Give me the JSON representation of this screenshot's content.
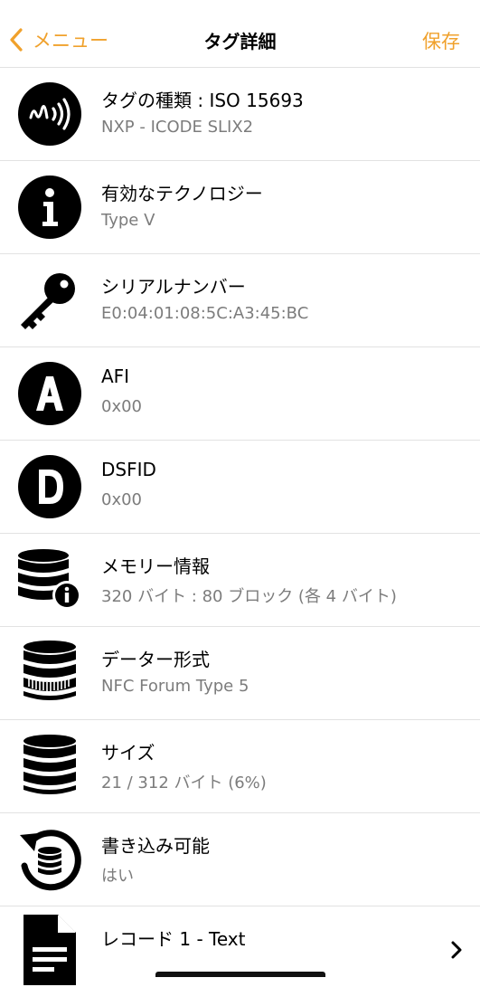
{
  "nav": {
    "back_label": "メニュー",
    "title": "タグ詳細",
    "save_label": "保存"
  },
  "rows": [
    {
      "title": "タグの種類 : ISO 15693",
      "value": "NXP - ICODE SLIX2",
      "icon": "nfc-tag-icon"
    },
    {
      "title": "有効なテクノロジー",
      "value": "Type V",
      "icon": "info-icon"
    },
    {
      "title": "シリアルナンバー",
      "value": "E0:04:01:08:5C:A3:45:BC",
      "icon": "key-icon"
    },
    {
      "title": "AFI",
      "value": "0x00",
      "icon": "letter-a-icon"
    },
    {
      "title": "DSFID",
      "value": "0x00",
      "icon": "letter-d-icon"
    },
    {
      "title": "メモリー情報",
      "value": "320 バイト : 80 ブロック (各 4 バイト)",
      "icon": "database-info-icon"
    },
    {
      "title": "データー形式",
      "value": "NFC Forum Type 5",
      "icon": "database-format-icon"
    },
    {
      "title": "サイズ",
      "value": "21 / 312 バイト (6%)",
      "icon": "database-icon"
    },
    {
      "title": "書き込み可能",
      "value": "はい",
      "icon": "rewritable-icon"
    },
    {
      "title": "レコード 1 - Text",
      "value": "",
      "icon": "document-icon"
    }
  ],
  "colors": {
    "accent": "#f0a12c",
    "secondary_text": "#7c7c7c",
    "separator": "#e2e2e2"
  }
}
